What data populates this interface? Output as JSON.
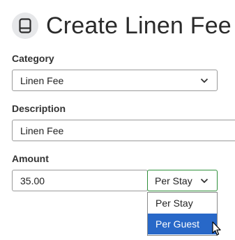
{
  "page": {
    "title": "Create Linen Fee",
    "logo_icon": "book-icon"
  },
  "form": {
    "category": {
      "label": "Category",
      "value": "Linen Fee"
    },
    "description": {
      "label": "Description",
      "value": "Linen Fee"
    },
    "amount": {
      "label": "Amount",
      "value": "35.00"
    },
    "fee_basis": {
      "value": "Per Stay",
      "options": [
        "Per Stay",
        "Per Guest"
      ],
      "highlighted": "Per Guest"
    }
  },
  "colors": {
    "accent_border": "#2f8f3a",
    "highlight": "#2868c8",
    "logo_bg": "#e6e7e9"
  }
}
